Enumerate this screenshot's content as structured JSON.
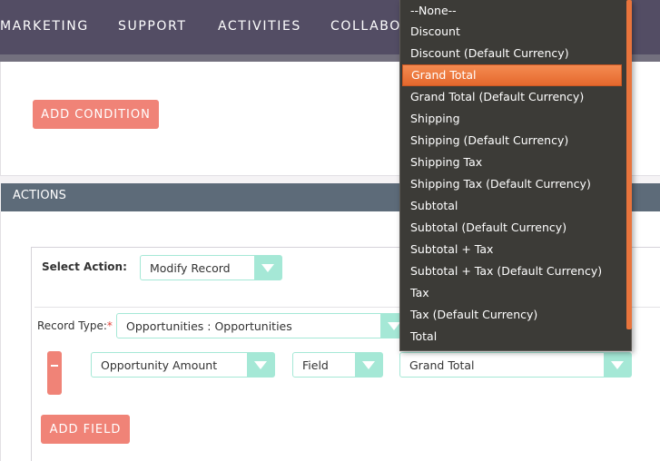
{
  "nav": {
    "items": [
      "MARKETING",
      "SUPPORT",
      "ACTIVITIES",
      "COLLABO"
    ]
  },
  "conditions": {
    "add_condition_label": "ADD CONDITION"
  },
  "actions": {
    "title": "ACTIONS",
    "select_action_label": "Select Action:",
    "select_action_value": "Modify Record",
    "record_type_label": "Record Type:",
    "record_type_required": "*",
    "record_type_value": "Opportunities : Opportunities",
    "field_row": {
      "field_value": "Opportunity Amount",
      "type_value": "Field",
      "target_value": "Grand Total"
    },
    "add_field_label": "ADD FIELD"
  },
  "dropdown": {
    "options": [
      "--None--",
      "Discount",
      "Discount (Default Currency)",
      "Grand Total",
      "Grand Total (Default Currency)",
      "Shipping",
      "Shipping (Default Currency)",
      "Shipping Tax",
      "Shipping Tax (Default Currency)",
      "Subtotal",
      "Subtotal (Default Currency)",
      "Subtotal + Tax",
      "Subtotal + Tax (Default Currency)",
      "Tax",
      "Tax (Default Currency)",
      "Total"
    ],
    "selected": "Grand Total"
  },
  "colors": {
    "nav_bg": "#534d64",
    "accent_button": "#f08377",
    "select_accent": "#a5e8d6",
    "actions_header": "#5d6b79",
    "dropdown_bg": "#3c3b37",
    "dropdown_highlight": "#e8743c"
  }
}
